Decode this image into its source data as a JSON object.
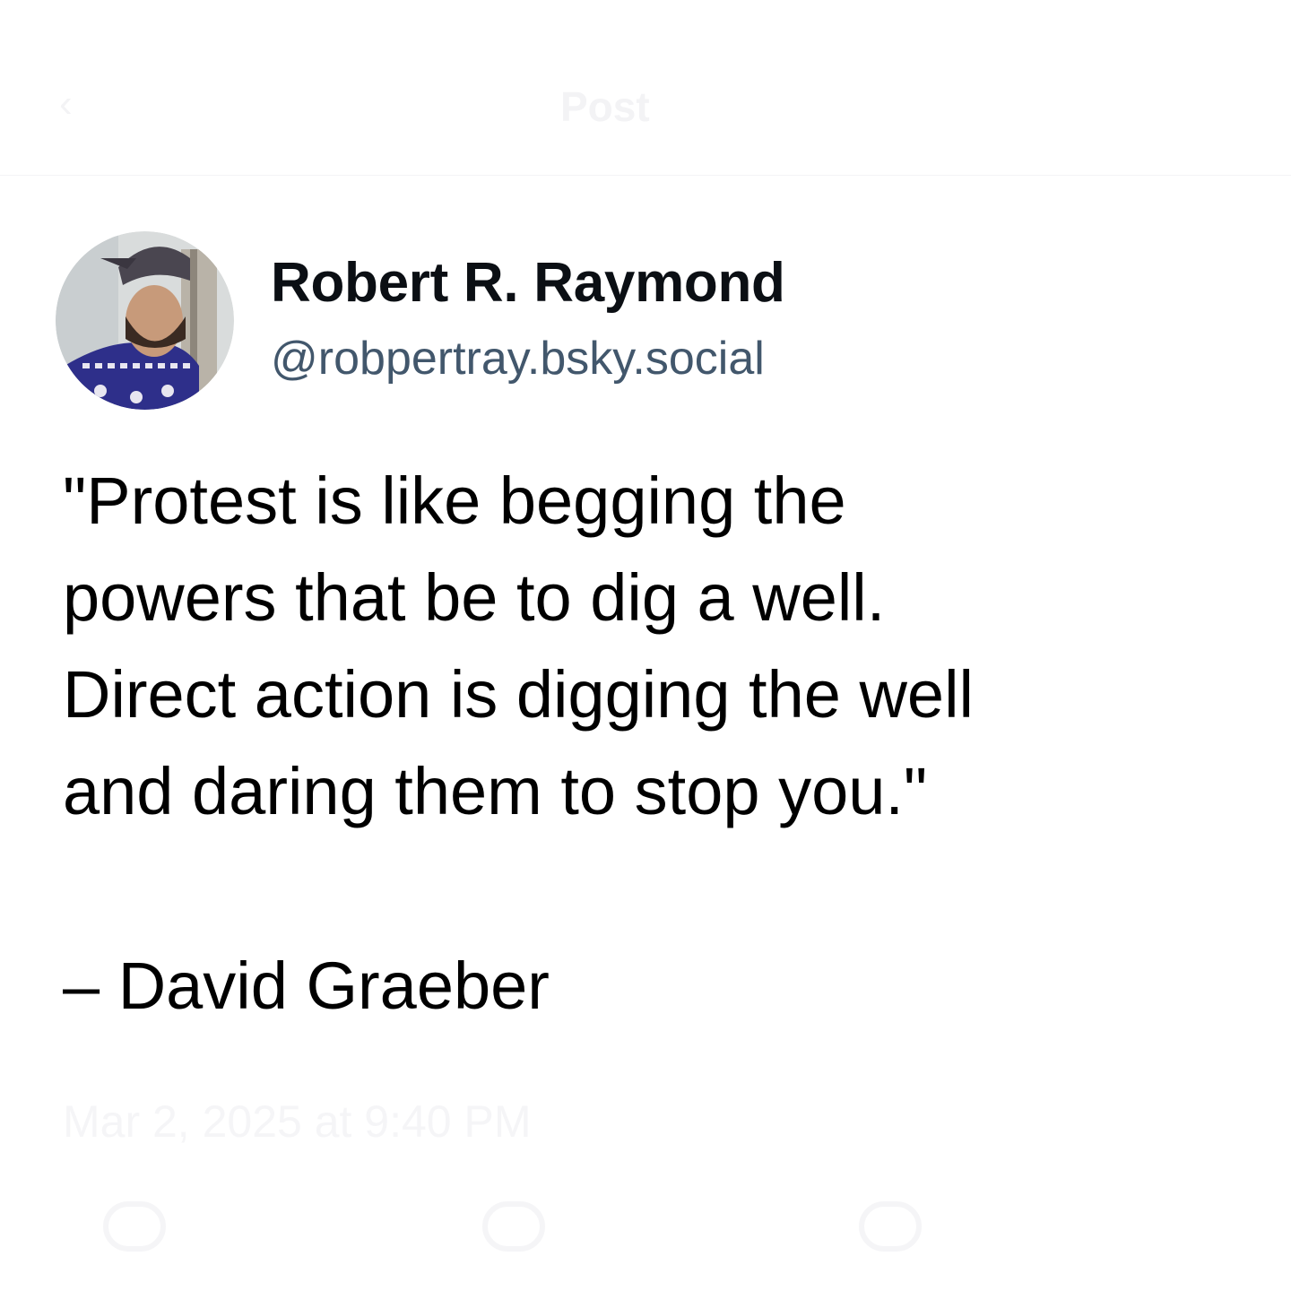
{
  "header": {
    "back_icon": "chevron-left-icon",
    "title": "Post"
  },
  "author": {
    "name": "Robert R. Raymond",
    "handle": "@robpertray.bsky.social",
    "avatar_icon": "avatar-photo"
  },
  "post": {
    "lines": [
      "\"Protest is like begging the",
      "powers that be to dig a well.",
      "Direct action is digging the well",
      "and daring them to stop you.\""
    ],
    "attribution": "– David Graeber"
  },
  "footer": {
    "timestamp": "Mar 2, 2025 at 9:40 PM",
    "actions": [
      "reply-icon",
      "repost-icon",
      "like-icon"
    ]
  }
}
